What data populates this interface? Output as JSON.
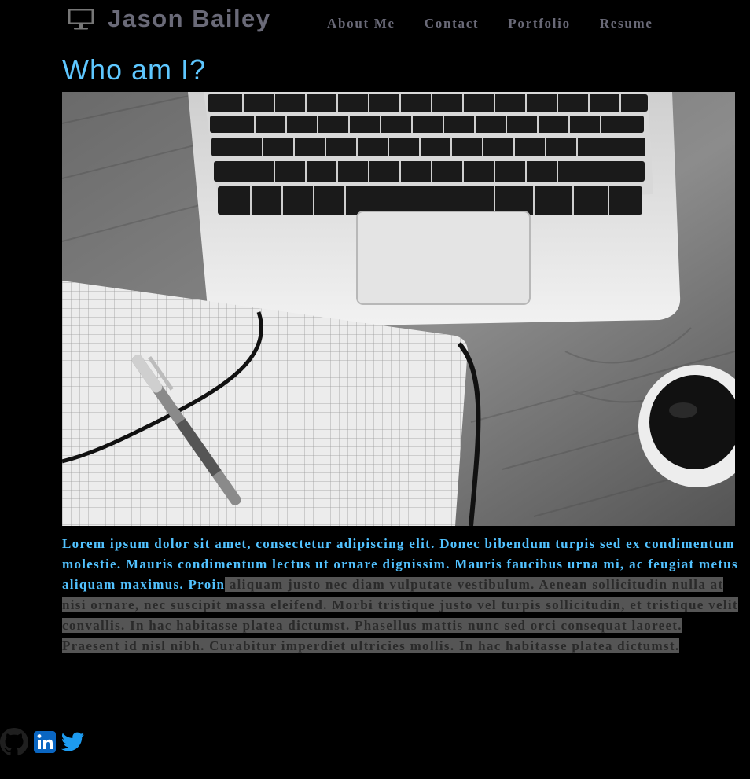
{
  "header": {
    "logo_icon": "monitor-icon",
    "name": "Jason Bailey",
    "nav": [
      {
        "label": "About Me"
      },
      {
        "label": "Contact"
      },
      {
        "label": "Portfolio"
      },
      {
        "label": "Resume"
      }
    ]
  },
  "main": {
    "title": "Who am I?",
    "hero_image": "laptop-notebook-pen-coffee-photo",
    "bio_highlighted": "Lorem ipsum dolor sit amet, consectetur adipiscing elit. Donec bibendum turpis sed ex condimentum molestie. Mauris condimentum lectus ut ornare dignissim. Mauris faucibus urna mi, ac feugiat metus aliquam maximus. Proin",
    "bio_selected": " aliquam justo nec diam vulputate vestibulum. Aenean sollicitudin nulla at nisi ornare, nec suscipit massa eleifend. Morbi tristique justo vel turpis sollicitudin, et tristique velit convallis. In hac habitasse platea dictumst. Phasellus mattis nunc sed orci consequat laoreet. Praesent id nisl nibh. Curabitur imperdiet ultricies mollis. In hac habitasse platea dictumst."
  },
  "social": [
    {
      "icon": "github-icon"
    },
    {
      "icon": "linkedin-icon"
    },
    {
      "icon": "twitter-icon"
    }
  ],
  "colors": {
    "background": "#000000",
    "header_text": "#6a6a78",
    "title": "#5ec7ff",
    "bio_text": "#52c2ff",
    "selection": "#555555",
    "linkedin": "#0a66c2",
    "twitter": "#1d9bf0"
  }
}
